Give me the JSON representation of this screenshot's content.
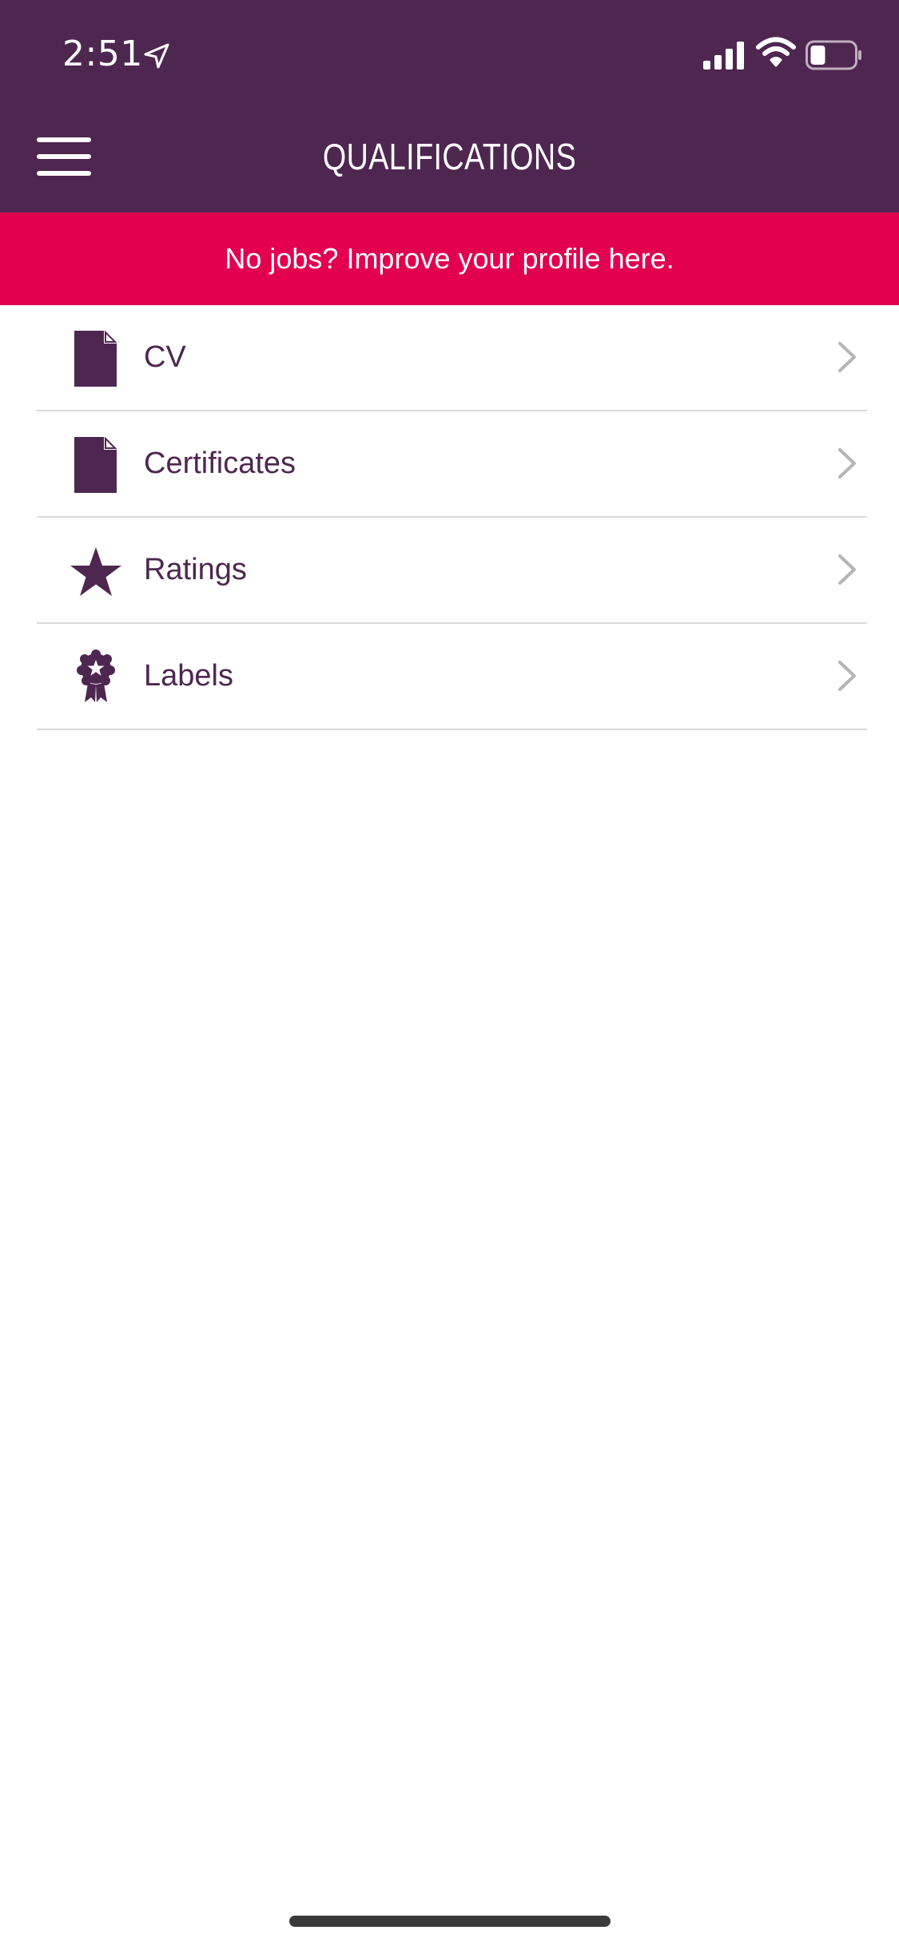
{
  "status_bar": {
    "time": "2:51"
  },
  "nav": {
    "title": "QUALIFICATIONS"
  },
  "banner": {
    "text": "No jobs? Improve your profile here."
  },
  "list": {
    "items": [
      {
        "label": "CV",
        "icon": "document-icon"
      },
      {
        "label": "Certificates",
        "icon": "document-icon"
      },
      {
        "label": "Ratings",
        "icon": "star-icon"
      },
      {
        "label": "Labels",
        "icon": "badge-icon"
      }
    ]
  },
  "colors": {
    "header_bg": "#4e2750",
    "banner_bg": "#e2004f",
    "accent": "#4e2750",
    "divider": "#d9d9d9",
    "chevron": "#b5b5b5"
  }
}
